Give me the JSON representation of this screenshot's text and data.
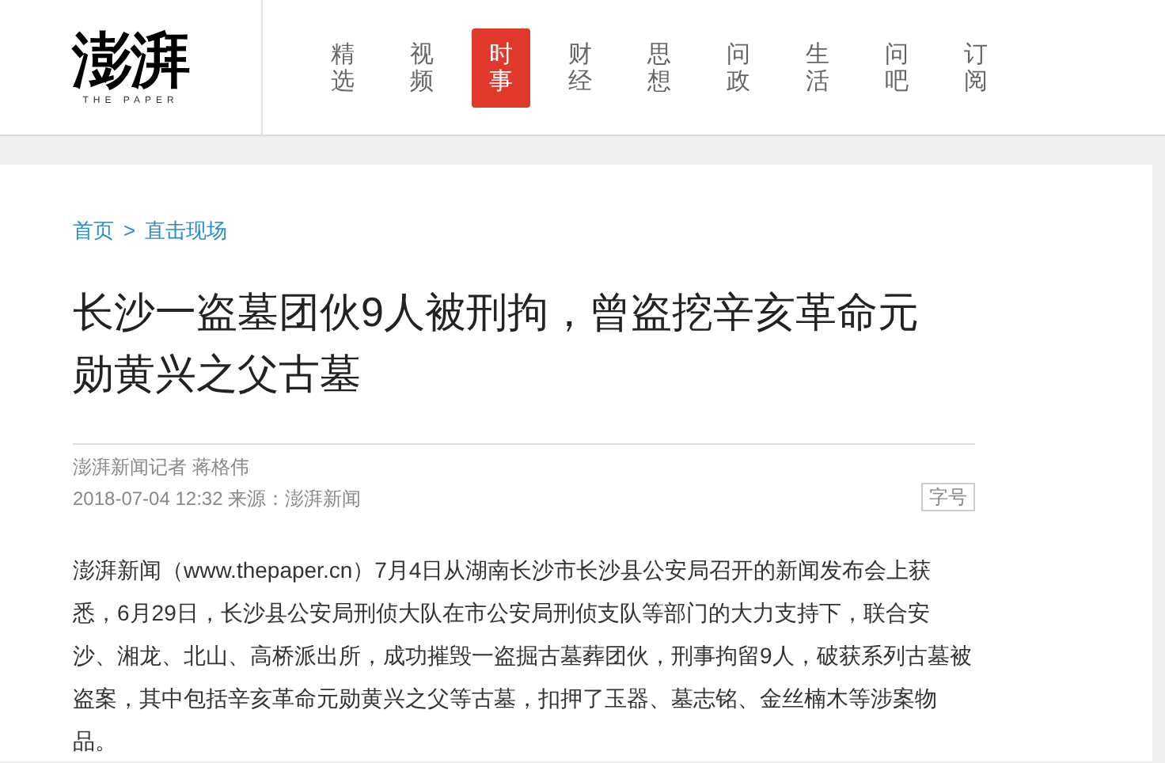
{
  "logo": {
    "name": "澎湃",
    "tagline": "THE PAPER"
  },
  "nav": [
    {
      "label": "精选",
      "selected": false
    },
    {
      "label": "视频",
      "selected": false
    },
    {
      "label": "时事",
      "selected": true
    },
    {
      "label": "财经",
      "selected": false
    },
    {
      "label": "思想",
      "selected": false
    },
    {
      "label": "问政",
      "selected": false
    },
    {
      "label": "生活",
      "selected": false
    },
    {
      "label": "问吧",
      "selected": false
    },
    {
      "label": "订阅",
      "selected": false
    }
  ],
  "breadcrumb": [
    "首页",
    ">",
    "直击现场"
  ],
  "article": {
    "title": "长沙一盗墓团伙9人被刑拘，曾盗挖辛亥革命元勋黄兴之父古墓",
    "author": "澎湃新闻记者 蒋格伟",
    "meta": "2018-07-04 12:32 来源：澎湃新闻",
    "font_size_button": "字号",
    "body": "澎湃新闻（www.thepaper.cn）7月4日从湖南长沙市长沙县公安局召开的新闻发布会上获悉，6月29日，长沙县公安局刑侦大队在市公安局刑侦支队等部门的大力支持下，联合安沙、湘龙、北山、高桥派出所，成功摧毁一盗掘古墓葬团伙，刑事拘留9人，破获系列古墓被盗案，其中包括辛亥革命元勋黄兴之父等古墓，扣押了玉器、墓志铭、金丝楠木等涉案物品。"
  }
}
